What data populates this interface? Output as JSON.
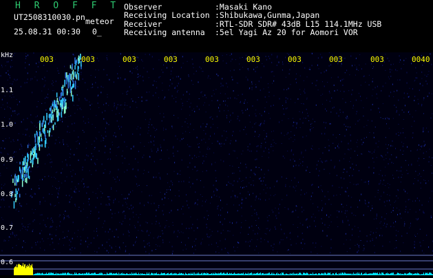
{
  "header": {
    "title": "H R O F F T",
    "file_name": "UT2508310030.pn",
    "meteor_label": "meteor",
    "date_time": "25.08.31 00:30",
    "counter": "0_"
  },
  "info": [
    {
      "label": "Observer",
      "value": ":Masaki Kano"
    },
    {
      "label": "Receiving Location",
      "value": ":Shibukawa,Gunma,Japan"
    },
    {
      "label": "Receiver",
      "value": ":RTL-SDR SDR# 43dB L15 114.1MHz USB"
    },
    {
      "label": "Receiving antenna",
      "value": ":5el Yagi Az 20 for Aomori VOR"
    }
  ],
  "axis": {
    "unit": "kHz",
    "y_ticks": [
      "1.1",
      "1.0",
      "0.9",
      "0.8",
      "0.7",
      "0.6"
    ],
    "time_ticks": [
      "003",
      "003",
      "003",
      "003",
      "003",
      "003",
      "003",
      "003",
      "003",
      "0040"
    ]
  },
  "colors": {
    "background": "#000000",
    "noise": "#0a0f5a",
    "signal": "#33ccff",
    "title": "#2ecc71",
    "tick": "#ffff00",
    "ylabel": "#ffffff",
    "baseline": "#ffff00",
    "bottom_trace": "#00e5ff"
  }
}
